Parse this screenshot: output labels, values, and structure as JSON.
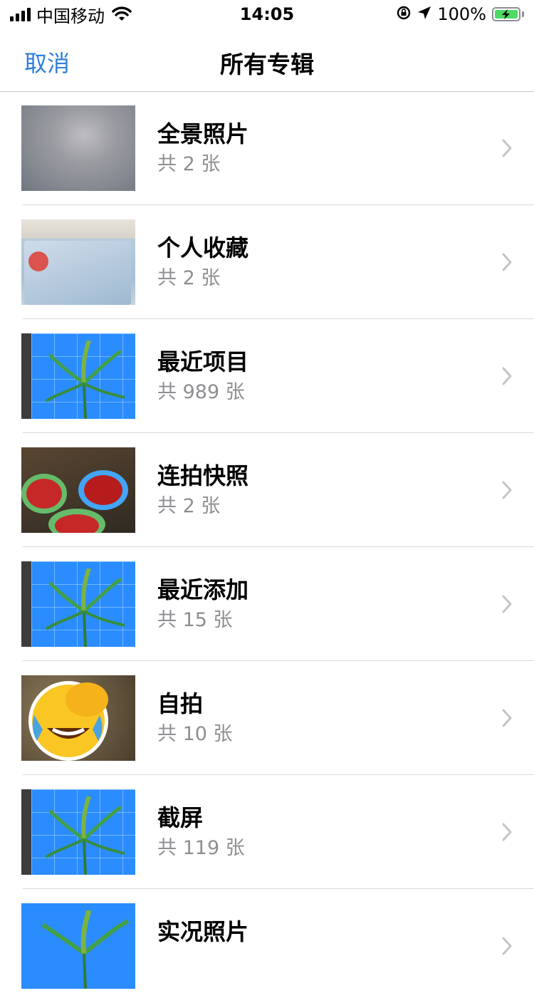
{
  "status_bar": {
    "carrier": "中国移动",
    "time": "14:05",
    "battery_percent": "100%",
    "battery_level": 1.0,
    "charging": true
  },
  "nav": {
    "cancel_label": "取消",
    "title": "所有专辑"
  },
  "albums": [
    {
      "name": "全景照片",
      "count": "共 2 张",
      "thumb": "blurred-gray"
    },
    {
      "name": "个人收藏",
      "count": "共 2 张",
      "thumb": "id-card"
    },
    {
      "name": "最近项目",
      "count": "共 989 张",
      "thumb": "plant-screenshot"
    },
    {
      "name": "连拍快照",
      "count": "共 2 张",
      "thumb": "strawberry-baskets"
    },
    {
      "name": "最近添加",
      "count": "共 15 张",
      "thumb": "plant-screenshot"
    },
    {
      "name": "自拍",
      "count": "共 10 张",
      "thumb": "laughing-emoji"
    },
    {
      "name": "截屏",
      "count": "共 119 张",
      "thumb": "plant-screenshot"
    },
    {
      "name": "实况照片",
      "count": "",
      "thumb": "plant-photo"
    }
  ],
  "colors": {
    "accent": "#2f7fd8",
    "secondary_text": "#8e8e93",
    "separator": "#d9d9de",
    "battery_fill": "#4cd964"
  }
}
